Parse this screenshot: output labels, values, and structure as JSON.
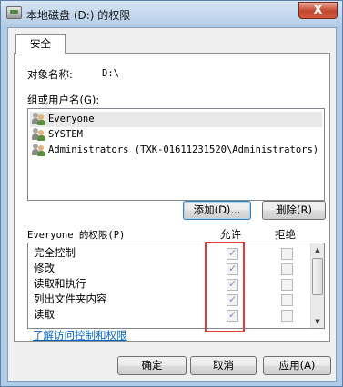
{
  "window": {
    "title": "本地磁盘 (D:) 的权限",
    "close_glyph": "X"
  },
  "tabs": [
    {
      "label": "安全"
    }
  ],
  "object": {
    "label": "对象名称:",
    "value": "D:\\"
  },
  "groups": {
    "label": "组或用户名(G):",
    "items": [
      {
        "name": "Everyone",
        "selected": true
      },
      {
        "name": "SYSTEM",
        "selected": false
      },
      {
        "name": "Administrators (TXK-01611231520\\Administrators)",
        "selected": false
      }
    ]
  },
  "buttons": {
    "add": "添加(D)...",
    "remove": "删除(R)",
    "ok": "确定",
    "cancel": "取消",
    "apply": "应用(A)"
  },
  "permissions": {
    "label": "Everyone 的权限(P)",
    "allow_header": "允许",
    "deny_header": "拒绝",
    "rows": [
      {
        "name": "完全控制",
        "allow": true,
        "deny": false
      },
      {
        "name": "修改",
        "allow": true,
        "deny": false
      },
      {
        "name": "读取和执行",
        "allow": true,
        "deny": false
      },
      {
        "name": "列出文件夹内容",
        "allow": true,
        "deny": false
      },
      {
        "name": "读取",
        "allow": true,
        "deny": false
      }
    ]
  },
  "link": {
    "label": "了解访问控制和权限"
  },
  "colors": {
    "highlight_box": "#e23b3b",
    "link": "#0066cc"
  }
}
